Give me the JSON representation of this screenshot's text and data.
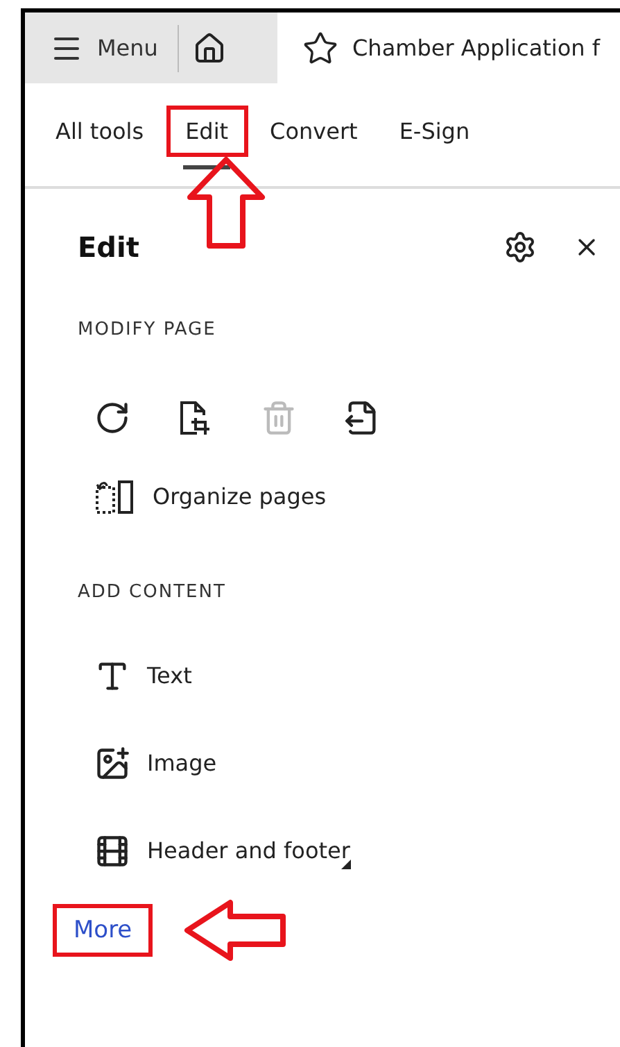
{
  "top_bar": {
    "menu_label": "Menu",
    "document_title": "Chamber Application f"
  },
  "tabs": [
    {
      "label": "All tools",
      "selected": false,
      "highlighted": false
    },
    {
      "label": "Edit",
      "selected": true,
      "highlighted": true
    },
    {
      "label": "Convert",
      "selected": false,
      "highlighted": false
    },
    {
      "label": "E-Sign",
      "selected": false,
      "highlighted": false
    }
  ],
  "panel": {
    "title": "Edit",
    "sections": [
      {
        "heading": "MODIFY PAGE",
        "tool_icons": [
          {
            "kind": "rotate",
            "disabled": false
          },
          {
            "kind": "crop",
            "disabled": false
          },
          {
            "kind": "delete",
            "disabled": true
          },
          {
            "kind": "extract",
            "disabled": false
          }
        ],
        "items": [
          {
            "kind": "organize",
            "label": "Organize pages",
            "submenu": false
          }
        ]
      },
      {
        "heading": "ADD CONTENT",
        "items": [
          {
            "kind": "text",
            "label": "Text",
            "submenu": false
          },
          {
            "kind": "image",
            "label": "Image",
            "submenu": false
          },
          {
            "kind": "header_footer",
            "label": "Header and footer",
            "submenu": true
          }
        ]
      }
    ],
    "more_link": {
      "label": "More",
      "highlighted": true
    }
  },
  "annotations": [
    {
      "kind": "arrow_up"
    },
    {
      "kind": "arrow_left"
    }
  ]
}
